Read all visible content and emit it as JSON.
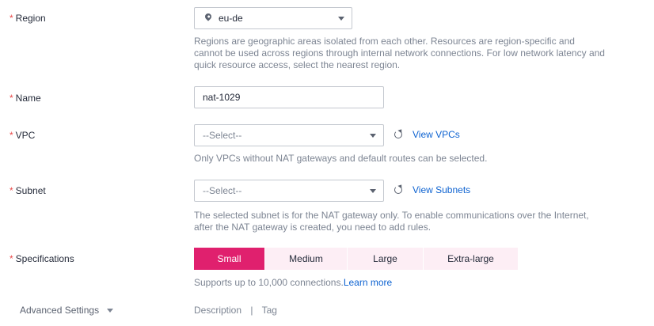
{
  "required_mark": "*",
  "region": {
    "label": "Region",
    "value": "eu-de",
    "hint": "Regions are geographic areas isolated from each other. Resources are region-specific and cannot be used across regions through internal network connections. For low network latency and quick resource access, select the nearest region."
  },
  "name": {
    "label": "Name",
    "value": "nat-1029"
  },
  "vpc": {
    "label": "VPC",
    "placeholder": "--Select--",
    "link": "View VPCs",
    "hint": "Only VPCs without NAT gateways and default routes can be selected."
  },
  "subnet": {
    "label": "Subnet",
    "placeholder": "--Select--",
    "link": "View Subnets",
    "hint": "The selected subnet is for the NAT gateway only. To enable communications over the Internet, after the NAT gateway is created, you need to add rules."
  },
  "specifications": {
    "label": "Specifications",
    "options": [
      "Small",
      "Medium",
      "Large",
      "Extra-large"
    ],
    "selected": "Small",
    "hint": "Supports up to 10,000 connections.",
    "learn_more": "Learn more"
  },
  "advanced": {
    "label": "Advanced Settings",
    "items": [
      "Description",
      "Tag"
    ],
    "separator": "|"
  },
  "colors": {
    "accent": "#e0206e",
    "accent_light": "#fdeef5",
    "link": "#0e63d1",
    "required": "#e94b4b"
  }
}
